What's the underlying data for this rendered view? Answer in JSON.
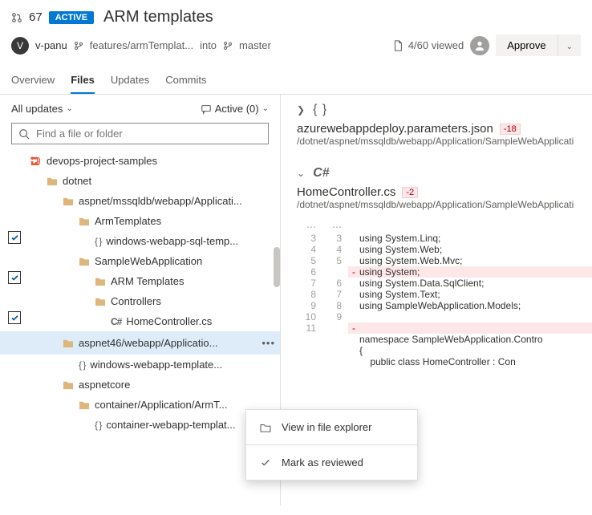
{
  "header": {
    "pr_number": "67",
    "badge": "ACTIVE",
    "title": "ARM templates",
    "avatar_initial": "V",
    "username": "v-panu",
    "source_branch": "features/armTemplat...",
    "into": "into",
    "target_branch": "master",
    "viewed": "4/60 viewed",
    "approve": "Approve"
  },
  "tabs": {
    "overview": "Overview",
    "files": "Files",
    "updates": "Updates",
    "commits": "Commits"
  },
  "sidebar": {
    "updates_filter": "All updates",
    "comments_filter": "Active (0)",
    "search_placeholder": "Find a file or folder",
    "tree": {
      "root": "devops-project-samples",
      "dotnet": "dotnet",
      "aspnet": "aspnet/mssqldb/webapp/Applicati...",
      "armtemplates": "ArmTemplates",
      "sqltemp": "windows-webapp-sql-temp...",
      "sample": "SampleWebApplication",
      "arm2": "ARM Templates",
      "controllers": "Controllers",
      "homecontroller": "HomeController.cs",
      "aspnet46": "aspnet46/webapp/Applicatio...",
      "wwtemplate": "windows-webapp-template...",
      "aspnetcore": "aspnetcore",
      "container": "container/Application/ArmT...",
      "containertemp": "container-webapp-templat..."
    }
  },
  "main": {
    "file1": {
      "name": "azurewebappdeploy.parameters.json",
      "diff": "-18",
      "path": "/dotnet/aspnet/mssqldb/webapp/Application/SampleWebApplicati"
    },
    "file2": {
      "lang": "C#",
      "name": "HomeController.cs",
      "diff": "-2",
      "path": "/dotnet/aspnet/mssqldb/webapp/Application/SampleWebApplicati"
    },
    "code": {
      "l3": "using System.Linq;",
      "l4": "using System.Web;",
      "l5": "using System.Web.Mvc;",
      "l6": "using System;",
      "l7": "using System.Data.SqlClient;",
      "l8": "using System.Text;",
      "l9": "using SampleWebApplication.Models;",
      "l12": "namespace SampleWebApplication.Contro",
      "l13": "{",
      "l14": "    public class HomeController : Con"
    }
  },
  "menu": {
    "view": "View in file explorer",
    "mark": "Mark as reviewed"
  }
}
